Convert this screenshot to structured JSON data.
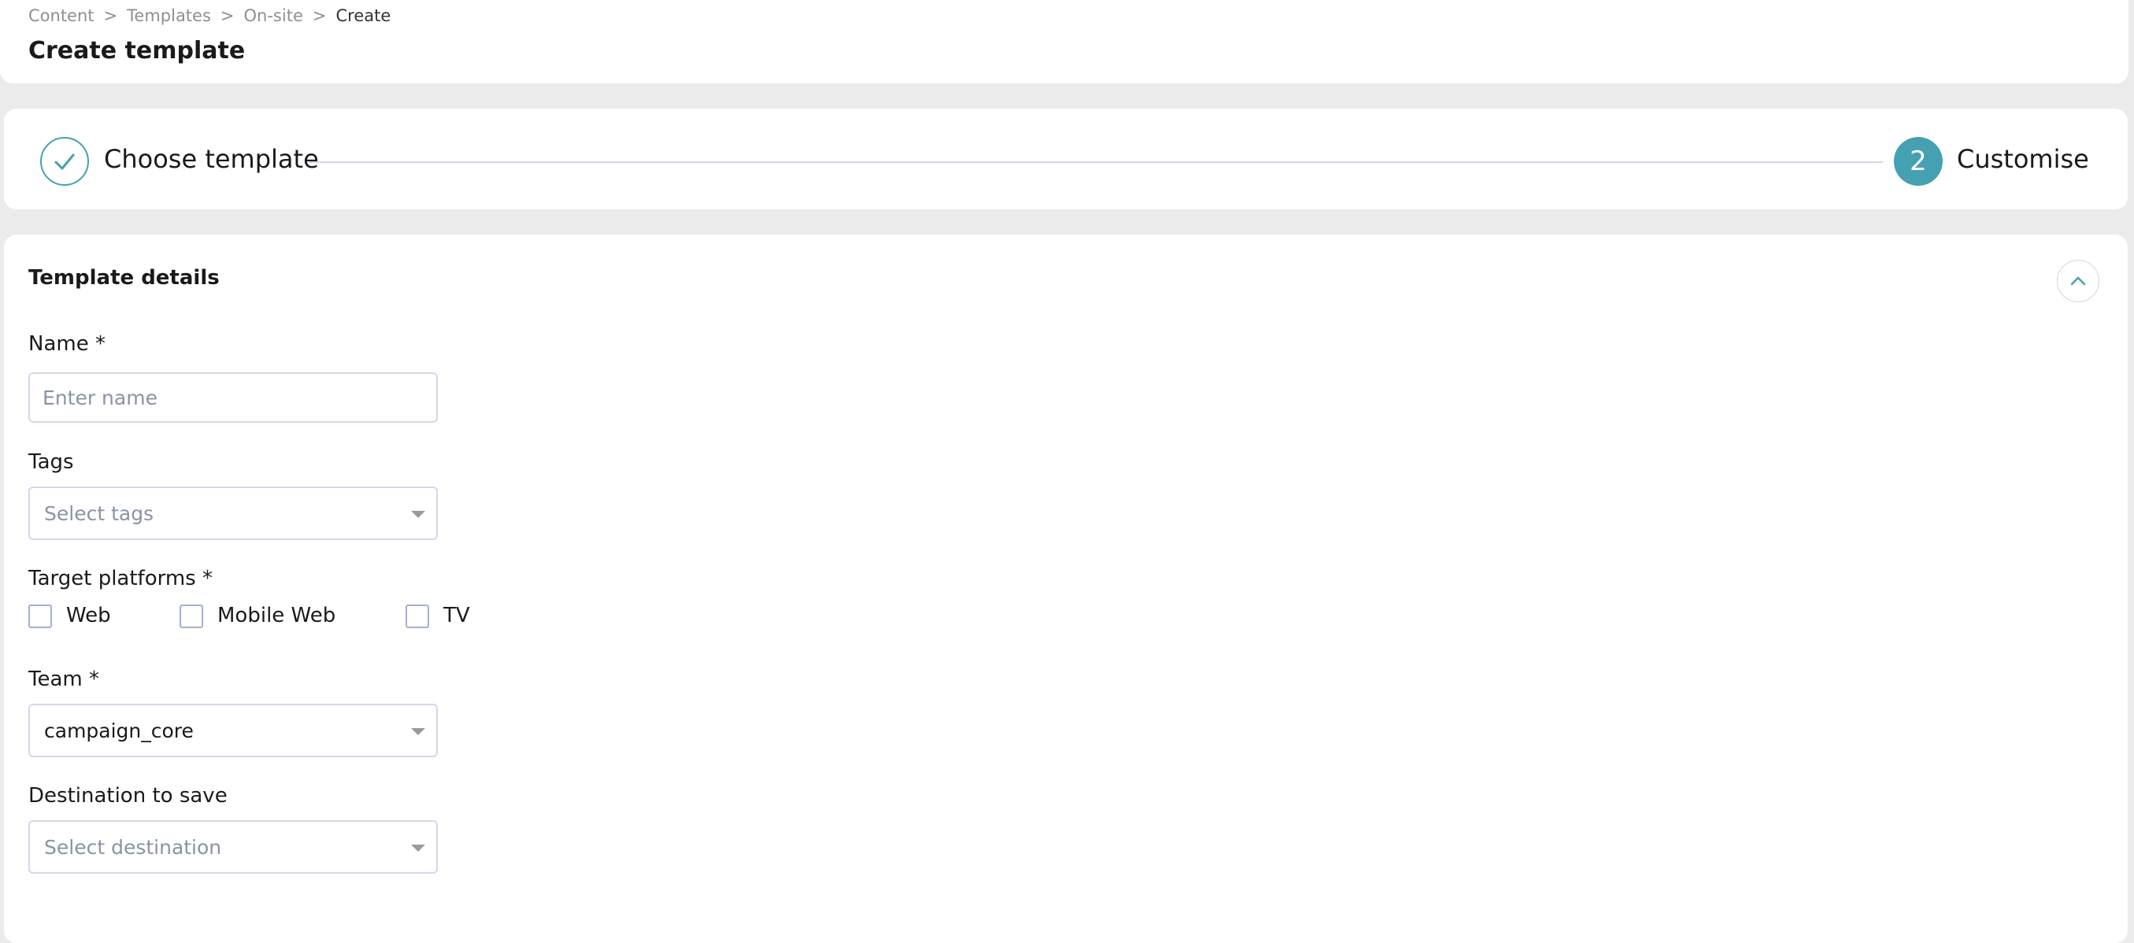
{
  "breadcrumb": {
    "items": [
      "Content",
      "Templates",
      "On-site"
    ],
    "current": "Create",
    "separator": ">"
  },
  "page": {
    "title": "Create template"
  },
  "stepper": {
    "steps": [
      {
        "number": "1",
        "label": "Choose template",
        "status": "completed",
        "icon": "check-icon"
      },
      {
        "number": "2",
        "label": "Customise",
        "status": "active"
      }
    ]
  },
  "details": {
    "title": "Template details",
    "collapse_icon": "chevron-up-icon",
    "name": {
      "label": "Name *",
      "placeholder": "Enter name",
      "value": ""
    },
    "tags": {
      "label": "Tags",
      "placeholder": "Select tags"
    },
    "target_platforms": {
      "label": "Target platforms *",
      "options": [
        {
          "label": "Web",
          "checked": false
        },
        {
          "label": "Mobile Web",
          "checked": false
        },
        {
          "label": "TV",
          "checked": false
        }
      ]
    },
    "team": {
      "label": "Team *",
      "value": "campaign_core"
    },
    "destination": {
      "label": "Destination to save",
      "placeholder": "Select destination"
    }
  },
  "colors": {
    "accent": "#45a1b1",
    "background": "#ebebeb",
    "card": "#ffffff",
    "input_border": "#d4d7ec",
    "placeholder": "#8a93a6"
  }
}
